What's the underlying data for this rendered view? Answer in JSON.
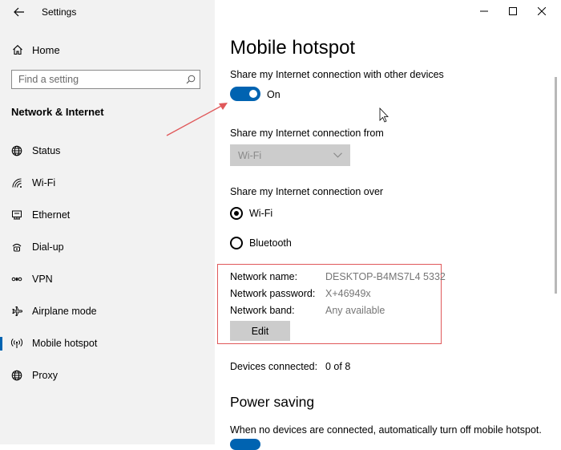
{
  "window": {
    "title": "Settings",
    "back_icon": "arrow-left-icon",
    "controls": [
      "minimize-icon",
      "maximize-icon",
      "close-icon"
    ]
  },
  "sidebar": {
    "home_label": "Home",
    "search_placeholder": "Find a setting",
    "section_title": "Network & Internet",
    "items": [
      {
        "label": "Status",
        "icon": "globe-icon"
      },
      {
        "label": "Wi-Fi",
        "icon": "wifi-icon"
      },
      {
        "label": "Ethernet",
        "icon": "ethernet-icon"
      },
      {
        "label": "Dial-up",
        "icon": "dialup-icon"
      },
      {
        "label": "VPN",
        "icon": "vpn-icon"
      },
      {
        "label": "Airplane mode",
        "icon": "airplane-icon"
      },
      {
        "label": "Mobile hotspot",
        "icon": "hotspot-icon",
        "active": true
      },
      {
        "label": "Proxy",
        "icon": "globe-icon"
      }
    ]
  },
  "main": {
    "title": "Mobile hotspot",
    "share_label": "Share my Internet connection with other devices",
    "toggle_state": "On",
    "share_from_label": "Share my Internet connection from",
    "share_from_value": "Wi-Fi",
    "share_over_label": "Share my Internet connection over",
    "share_over_options": [
      {
        "label": "Wi-Fi",
        "selected": true
      },
      {
        "label": "Bluetooth",
        "selected": false
      }
    ],
    "network": {
      "name_label": "Network name:",
      "name_value": "DESKTOP-B4MS7L4 5332",
      "password_label": "Network password:",
      "password_value": "X+46949x",
      "band_label": "Network band:",
      "band_value": "Any available",
      "edit_label": "Edit"
    },
    "devices_label": "Devices connected:",
    "devices_value": "0 of 8",
    "power_saving_title": "Power saving",
    "power_saving_desc": "When no devices are connected, automatically turn off mobile hotspot."
  },
  "colors": {
    "accent": "#0063b1",
    "sidebar_bg": "#f2f2f2",
    "annotation_red": "#e0585a",
    "disabled_bg": "#cccccc"
  }
}
